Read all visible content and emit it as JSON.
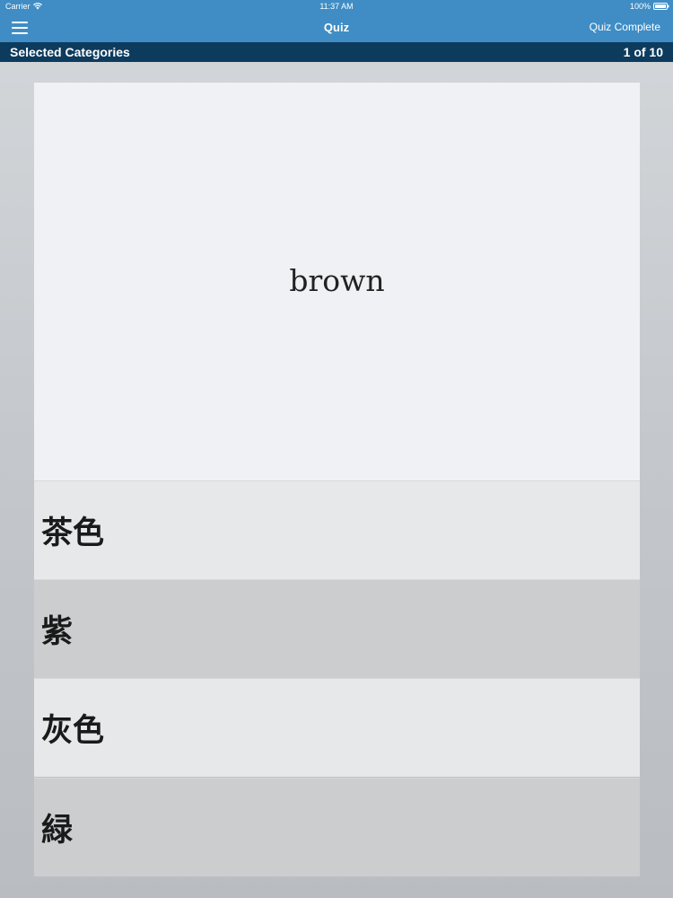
{
  "status_bar": {
    "carrier": "Carrier",
    "time": "11:37 AM",
    "battery": "100%"
  },
  "nav": {
    "title": "Quiz",
    "complete_label": "Quiz Complete"
  },
  "category_bar": {
    "label": "Selected Categories",
    "progress": "1 of 10"
  },
  "quiz": {
    "prompt": "brown",
    "answers": [
      {
        "text": "茶色"
      },
      {
        "text": "紫"
      },
      {
        "text": "灰色"
      },
      {
        "text": "緑"
      }
    ]
  },
  "colors": {
    "nav_blue": "#3f8dc4",
    "category_navy": "#0d3b5e"
  }
}
